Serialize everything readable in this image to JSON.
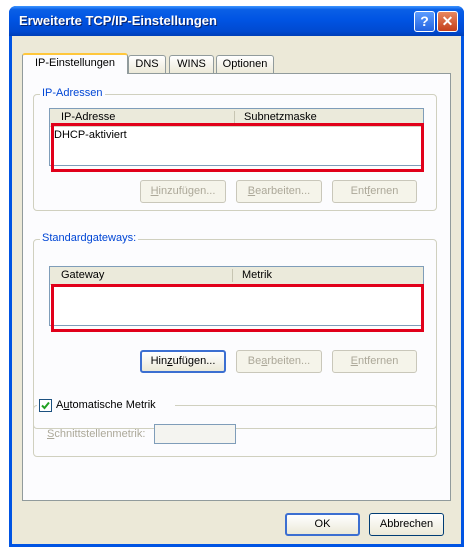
{
  "window": {
    "title": "Erweiterte TCP/IP-Einstellungen",
    "help_glyph": "?",
    "close_glyph": "✕"
  },
  "tabs": [
    {
      "label": "IP-Einstellungen",
      "active": true
    },
    {
      "label": "DNS",
      "active": false
    },
    {
      "label": "WINS",
      "active": false
    },
    {
      "label": "Optionen",
      "active": false
    }
  ],
  "ip_addresses": {
    "legend": "IP-Adressen",
    "columns": [
      "IP-Adresse",
      "Subnetzmaske"
    ],
    "rows": [
      [
        "DHCP-aktiviert",
        ""
      ]
    ],
    "buttons": {
      "add": "Hinzufügen...",
      "edit": "Bearbeiten...",
      "remove": "Entfernen"
    }
  },
  "gateways": {
    "legend": "Standardgateways:",
    "columns": [
      "Gateway",
      "Metrik"
    ],
    "rows": [],
    "buttons": {
      "add": "Hinzufügen...",
      "edit": "Bearbeiten...",
      "remove": "Entfernen"
    }
  },
  "auto_metric": {
    "label": "Automatische Metrik",
    "checked": true
  },
  "interface_metric": {
    "label": "Schnittstellenmetrik:",
    "value": ""
  },
  "footer": {
    "ok": "OK",
    "cancel": "Abbrechen"
  },
  "colors": {
    "highlight_box": "#e1001a",
    "title_bar": "#0054e3",
    "dialog_bg": "#ece9d8"
  }
}
